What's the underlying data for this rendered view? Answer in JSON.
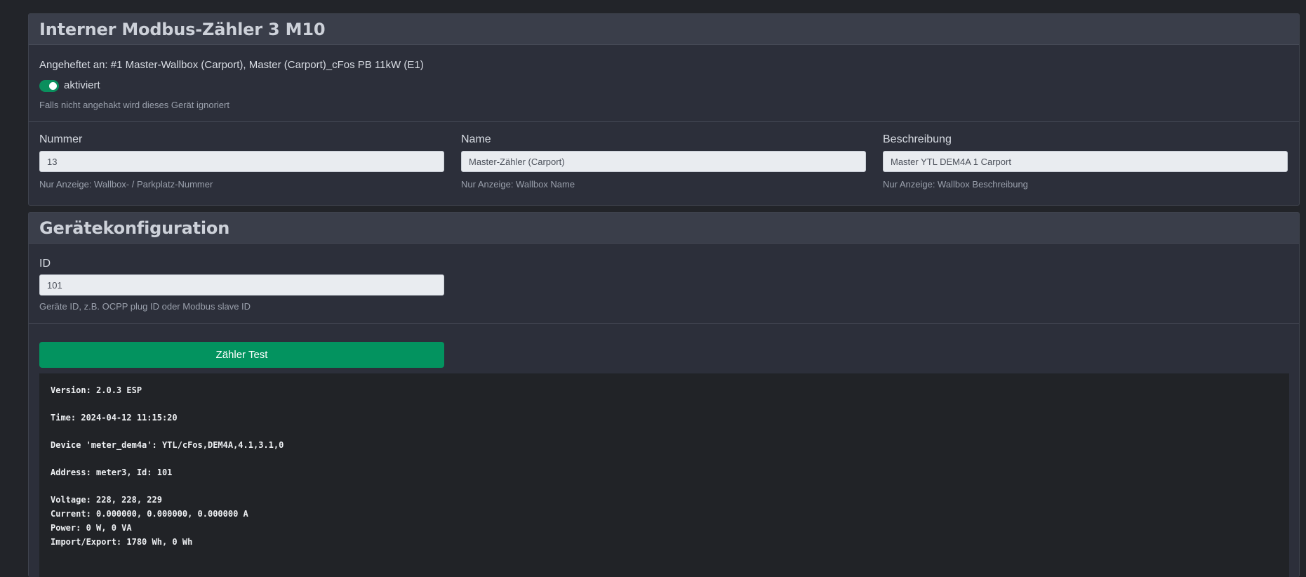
{
  "meter_panel": {
    "title": "Interner Modbus-Zähler 3 M10",
    "attached_to": "Angeheftet an: #1 Master-Wallbox (Carport), Master (Carport)_cFos PB 11kW (E1)",
    "enabled_label": "aktiviert",
    "enabled_hint": "Falls nicht angehakt wird dieses Gerät ignoriert",
    "fields": {
      "number": {
        "label": "Nummer",
        "value": "13",
        "hint": "Nur Anzeige: Wallbox- / Parkplatz-Nummer"
      },
      "name": {
        "label": "Name",
        "value": "Master-Zähler (Carport)",
        "hint": "Nur Anzeige: Wallbox Name"
      },
      "description": {
        "label": "Beschreibung",
        "value": "Master YTL DEM4A 1 Carport",
        "hint": "Nur Anzeige: Wallbox Beschreibung"
      }
    }
  },
  "config_panel": {
    "title": "Gerätekonfiguration",
    "id_field": {
      "label": "ID",
      "value": "101",
      "hint": "Geräte ID, z.B. OCPP plug ID oder Modbus slave ID"
    },
    "test_button": "Zähler Test",
    "console": {
      "version": "Version: 2.0.3 ESP",
      "time": "Time: 2024-04-12 11:15:20",
      "device": "Device 'meter_dem4a': YTL/cFos,DEM4A,4.1,3.1,0",
      "address": "Address: meter3, Id: 101",
      "voltage": "Voltage: 228, 228, 229",
      "current": "Current: 0.000000, 0.000000, 0.000000 A",
      "power": "Power: 0 W, 0 VA",
      "import_export": "Import/Export: 1780 Wh, 0 Wh"
    }
  },
  "colors": {
    "background": "#222429",
    "panel": "#2c2f3a",
    "accent_green": "#03935f"
  }
}
